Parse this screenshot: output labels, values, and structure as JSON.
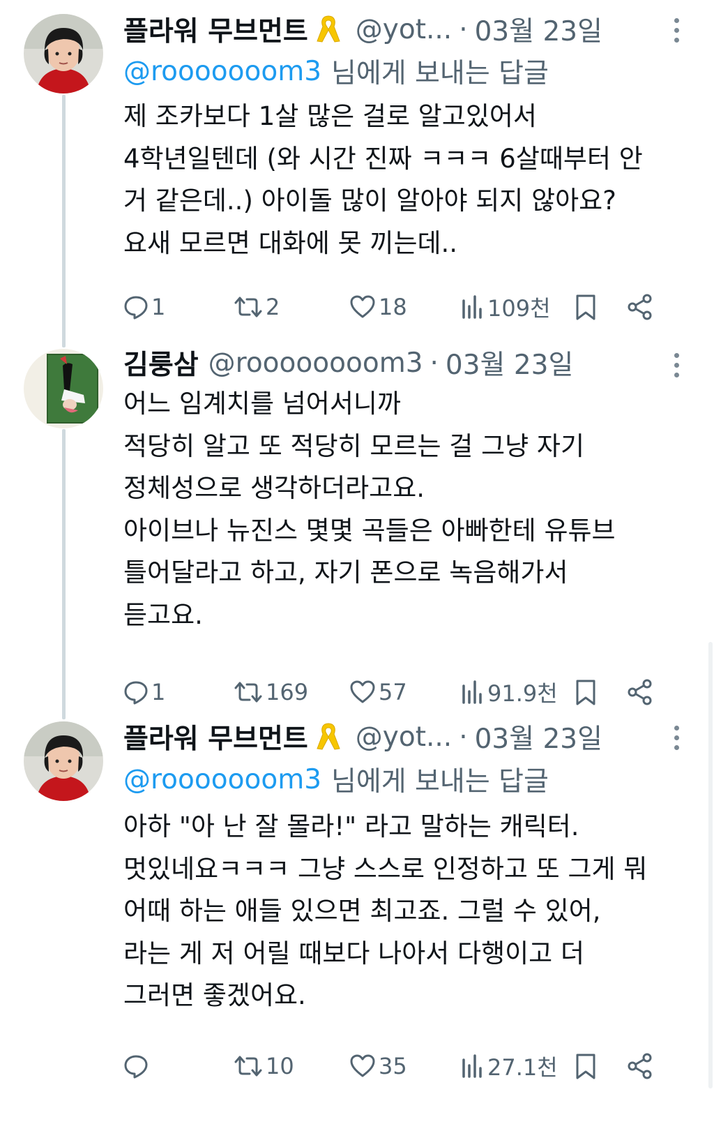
{
  "tweets": [
    {
      "author_name": "플라워 무브먼트",
      "has_ribbon": true,
      "handle": "@yot...",
      "separator": "·",
      "date": "03월 23일",
      "reply_prefix": "@rooooooom3",
      "reply_suffix": "님에게 보내는 답글",
      "body_lines": [
        "제 조카보다 1살 많은 걸로 알고있어서",
        "4학년일텐데 (와 시간 진짜 ㅋㅋㅋ 6살때부터 안",
        "거 같은데..) 아이돌 많이 알아야 되지 않아요?",
        "요새 모르면 대화에 못 끼는데.."
      ],
      "stats": {
        "replies": "1",
        "retweets": "2",
        "likes": "18",
        "views": "109천"
      },
      "avatar": "child-red-coat"
    },
    {
      "author_name": "김룽삼",
      "has_ribbon": false,
      "handle": "@roooooooom3",
      "separator": "·",
      "date": "03월 23일",
      "reply_prefix": "",
      "reply_suffix": "",
      "body_lines": [
        "어느 임계치를 넘어서니까",
        "적당히 알고 또 적당히 모르는 걸 그냥 자기",
        "정체성으로 생각하더라고요.",
        "아이브나 뉴진스 몇몇 곡들은 아빠한테 유튜브",
        "틀어달라고 하고, 자기 폰으로 녹음해가서",
        "듣고요."
      ],
      "stats": {
        "replies": "1",
        "retweets": "169",
        "likes": "57",
        "views": "91.9천"
      },
      "avatar": "illustration-lying-figure"
    },
    {
      "author_name": "플라워 무브먼트",
      "has_ribbon": true,
      "handle": "@yot...",
      "separator": "·",
      "date": "03월 23일",
      "reply_prefix": "@rooooooom3",
      "reply_suffix": "님에게 보내는 답글",
      "body_lines": [
        "아하 \"아 난 잘 몰라!\" 라고 말하는 캐릭터.",
        "멋있네요ㅋㅋㅋ 그냥 스스로 인정하고 또 그게 뭐",
        "어때 하는 애들 있으면 최고죠. 그럴 수 있어,",
        "라는 게 저 어릴 때보다 나아서 다행이고 더",
        "그러면 좋겠어요."
      ],
      "stats": {
        "replies": "",
        "retweets": "10",
        "likes": "35",
        "views": "27.1천"
      },
      "avatar": "child-red-coat"
    }
  ],
  "icons": {
    "reply": "speech-bubble-icon",
    "retweet": "retweet-arrows-icon",
    "like": "heart-icon",
    "views": "bar-chart-icon",
    "bookmark": "bookmark-icon",
    "share": "share-icon",
    "more": "vertical-ellipsis-icon",
    "ribbon": "yellow-ribbon-icon"
  },
  "colors": {
    "link_blue": "#1d9bf0",
    "secondary_text": "#536471",
    "ribbon_yellow": "#f7c600",
    "thread_line": "#cfd9de"
  }
}
